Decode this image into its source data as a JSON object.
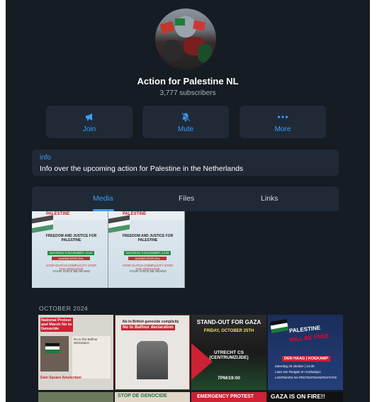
{
  "channel": {
    "name": "Action for Palestine NL",
    "subscribers": "3,777 subscribers"
  },
  "actions": {
    "join_label": "Join",
    "mute_label": "Mute",
    "more_label": "More",
    "join_icon": "megaphone-icon",
    "mute_icon": "bell-slash-icon",
    "more_icon": "ellipsis-icon"
  },
  "info": {
    "label": "info",
    "text": "Info over the upcoming action for Palestine in the Netherlands"
  },
  "tabs": [
    {
      "label": "Media",
      "active": true
    },
    {
      "label": "Files",
      "active": false
    },
    {
      "label": "Links",
      "active": false
    }
  ],
  "media": {
    "pinned": [
      {
        "title": "PALESTINE",
        "line1": "FREEDOM AND JUSTICE FOR PALESTINE",
        "bar1": "SATURDAY 9 NOVEMBER, 13:00",
        "bar2": "JAARBEURSPLEIN, UTRECHT",
        "line2": "STOP DUTCH COMPLICITY STOP THE GENOCIDE",
        "line3": "YOUR VOICE BE HEARD"
      },
      {
        "title": "PALESTINE",
        "line1": "FREEDOM AND JUSTICE FOR PALESTINE",
        "bar1": "SATURDAY 9 NOVEMBER, 13:00",
        "bar2": "JAARBEURSPLEIN, UTRECHT",
        "line2": "STOP DUTCH COMPLICITY STOP THE GENOCIDE",
        "line3": "YOUR VOICE BE HEARD"
      }
    ],
    "section_label": "OCTOBER 2024",
    "grid": {
      "g1_title": "National Protest and March No to Genocide",
      "g1_side": "No to the Balfour declaration",
      "g1_foot": "Dam Square Amsterdam",
      "g2_t1": "No to British genocide complicity",
      "g2_t2": "No to Balfour declaration",
      "g3_t1": "STAND-OUT FOR GAZA",
      "g3_t2": "FRIDAY, OCTOBER 25TH",
      "g3_t3": "UTRECHT CS (CENTRUMZIJDE)",
      "g3_t4": "7PM/19:00",
      "g4_t1": "PALESTINE",
      "g4_t2": "WILL BE FREE",
      "g4_t3": "DEN HAAG | KOEKAMP",
      "g4_t4": "Zaterdag 26 oktober | 14:30",
      "g4_t5": "Laan van Reagan en Gorbatsjov",
      "g4_t6": "LOOPMARS NA PROTESTMANIFESTATIE",
      "h2": "STOP DE GENOCIDE",
      "h3": "EMERGENCY PROTEST",
      "h4": "GAZA IS ON FIRE!!"
    }
  },
  "colors": {
    "accent": "#3d9bff",
    "panel_bg": "#161c24",
    "card_bg": "#1f2a36"
  }
}
